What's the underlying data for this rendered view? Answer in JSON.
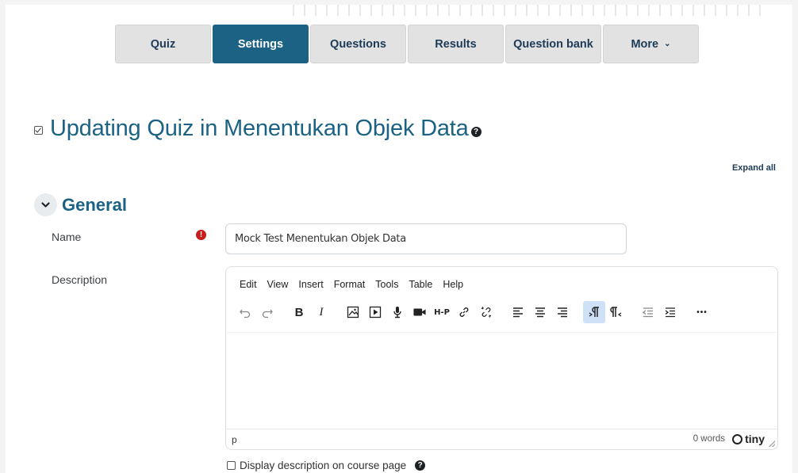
{
  "nav": {
    "tabs": [
      {
        "label": "Quiz"
      },
      {
        "label": "Settings"
      },
      {
        "label": "Questions"
      },
      {
        "label": "Results"
      },
      {
        "label": "Question bank"
      },
      {
        "label": "More"
      }
    ],
    "active_tab": "Settings"
  },
  "page": {
    "title": "Updating Quiz in Menentukan Objek Data",
    "help_glyph": "?",
    "expand_all": "Expand all"
  },
  "section": {
    "title": "General"
  },
  "form": {
    "name_label": "Name",
    "required_glyph": "!",
    "name_value": "Mock Test Menentukan Objek Data",
    "description_label": "Description",
    "display_description_label": "Display description on course page",
    "display_description_checked": false
  },
  "editor": {
    "menu": [
      "Edit",
      "View",
      "Insert",
      "Format",
      "Tools",
      "Table",
      "Help"
    ],
    "status_path": "p",
    "word_count": "0 words",
    "brand": "tiny",
    "toolbar_icons": [
      "undo-icon",
      "redo-icon",
      "bold-icon",
      "italic-icon",
      "image-icon",
      "media-icon",
      "microphone-icon",
      "video-camera-icon",
      "h5p-icon",
      "link-icon",
      "unlink-icon",
      "align-left-icon",
      "align-center-icon",
      "align-right-icon",
      "ltr-icon",
      "rtl-icon",
      "outdent-icon",
      "indent-icon",
      "more-icon"
    ],
    "text": {
      "bold": "B",
      "italic": "I",
      "h5p": "H-P",
      "more": "•••"
    }
  },
  "colors": {
    "accent": "#1b6284",
    "tab_bg": "#e2e2e2",
    "required": "#c91d1d",
    "active_tool": "#cfe1f7"
  }
}
